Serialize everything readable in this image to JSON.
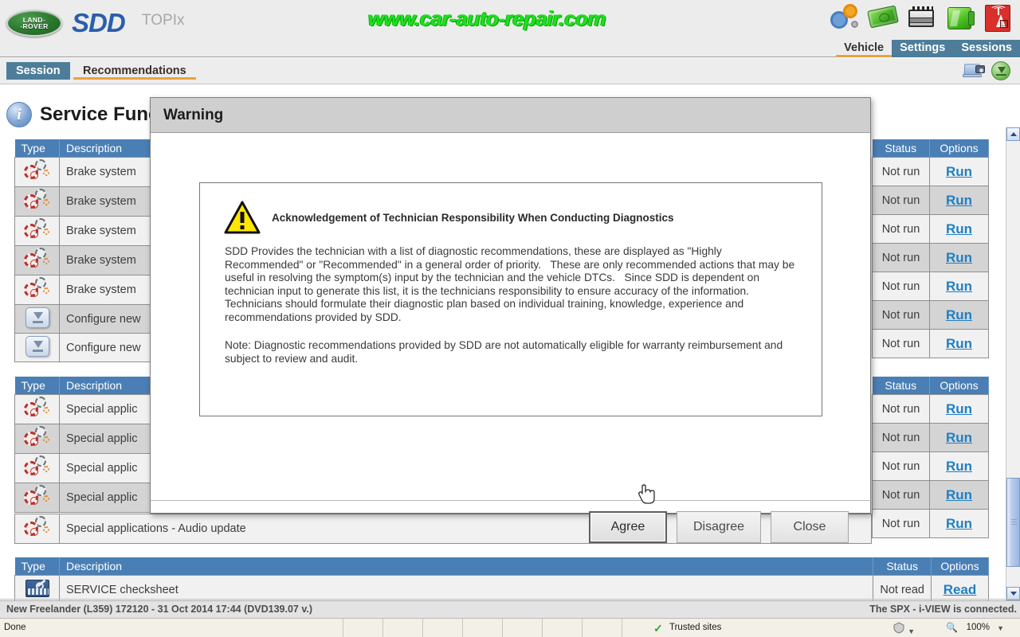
{
  "header": {
    "logo_line1": "LAND-",
    "logo_line2": "-ROVER",
    "app_name": "SDD",
    "secondary_name": "TOPIx",
    "watermark": "www.car-auto-repair.com",
    "icons": [
      "gears-icon",
      "money-icon",
      "battery-icon",
      "fuel-can-icon",
      "signal-icon"
    ],
    "nav": [
      {
        "label": "Vehicle",
        "active": true
      },
      {
        "label": "Settings",
        "active": false
      },
      {
        "label": "Sessions",
        "active": false
      }
    ]
  },
  "tabs": [
    {
      "label": "Session",
      "selected": true
    },
    {
      "label": "Recommendations",
      "selected": false
    }
  ],
  "tab_icons": [
    "screenshot-icon",
    "download-icon"
  ],
  "page": {
    "title": "Service Functions",
    "info_glyph": "i"
  },
  "tables": [
    {
      "headers": {
        "type": "Type",
        "description": "Description",
        "status": "Status",
        "options": "Options"
      },
      "rows": [
        {
          "icon": "gear-clock-icon",
          "description": "Brake system",
          "status": "Not run",
          "option": "Run"
        },
        {
          "icon": "gear-clock-icon",
          "description": "Brake system",
          "status": "Not run",
          "option": "Run"
        },
        {
          "icon": "gear-clock-icon",
          "description": "Brake system",
          "status": "Not run",
          "option": "Run"
        },
        {
          "icon": "gear-clock-icon",
          "description": "Brake system",
          "status": "Not run",
          "option": "Run"
        },
        {
          "icon": "gear-clock-icon",
          "description": "Brake system",
          "status": "Not run",
          "option": "Run"
        },
        {
          "icon": "download-box-icon",
          "description": "Configure new",
          "status": "Not run",
          "option": "Run"
        },
        {
          "icon": "download-box-icon",
          "description": "Configure new",
          "status": "Not run",
          "option": "Run"
        }
      ]
    },
    {
      "headers": {
        "type": "Type",
        "description": "Description",
        "status": "Status",
        "options": "Options"
      },
      "rows": [
        {
          "icon": "gear-clock-icon",
          "description": "Special applic",
          "status": "Not run",
          "option": "Run"
        },
        {
          "icon": "gear-clock-icon",
          "description": "Special applic",
          "status": "Not run",
          "option": "Run"
        },
        {
          "icon": "gear-clock-icon",
          "description": "Special applic",
          "status": "Not run",
          "option": "Run"
        },
        {
          "icon": "gear-clock-icon",
          "description": "Special applic",
          "status": "Not run",
          "option": "Run"
        },
        {
          "icon": "gear-clock-icon",
          "description": "Special applications - Audio update",
          "status": "Not run",
          "option": "Run"
        }
      ]
    },
    {
      "headers": {
        "type": "Type",
        "description": "Description",
        "status": "Status",
        "options": "Options"
      },
      "rows": [
        {
          "icon": "checksheet-icon",
          "description": "SERVICE checksheet",
          "status": "Not read",
          "option": "Read"
        }
      ]
    }
  ],
  "dialog": {
    "title": "Warning",
    "warning_icon": "warning-triangle-icon",
    "heading": "Acknowledgement of Technician Responsibility When Conducting Diagnostics",
    "paragraph1": "SDD Provides the technician with a list of diagnostic recommendations, these are displayed as \"Highly Recommended\" or \"Recommended\" in a general order of priority.   These are only recommended actions that may be useful in resolving the symptom(s) input by the technician and the vehicle DTCs.   Since SDD is dependent on technician input to generate this list, it is the technicians responsibility to ensure accuracy of the information.   Technicians should formulate their diagnostic plan based on individual training, knowledge, experience and recommendations provided by SDD.",
    "paragraph2": "Note: Diagnostic recommendations provided by SDD are not automatically eligible for warranty reimbursement and subject to review and audit.",
    "buttons": [
      {
        "label": "Agree",
        "focused": true
      },
      {
        "label": "Disagree",
        "focused": false
      },
      {
        "label": "Close",
        "focused": false
      }
    ]
  },
  "status_bar": {
    "vehicle_info": "New Freelander (L359) 172120 - 31 Oct 2014 17:44 (DVD139.07 v.)",
    "connection": "The SPX - i-VIEW is connected."
  },
  "browser_bar": {
    "status": "Done",
    "zone": "Trusted sites",
    "zoom": "100%"
  },
  "colors": {
    "header_bg": "#ececec",
    "tab_active": "#4d7d99",
    "table_header": "#4a7fb5",
    "link": "#1f7fc4",
    "accent_underline": "#e8a33d",
    "watermark": "#22dd22",
    "warning_yellow": "#ffe600"
  }
}
